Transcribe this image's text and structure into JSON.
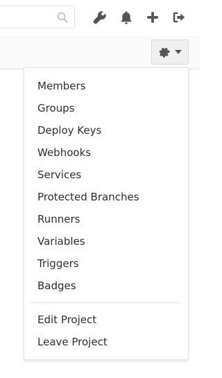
{
  "header": {
    "search": {
      "partial_text": "n"
    },
    "icons": [
      "search-icon",
      "wrench-icon",
      "bell-icon",
      "plus-icon",
      "sign-out-icon"
    ]
  },
  "settings_button": {
    "icon": "gear-icon",
    "caret": "chevron-down-icon"
  },
  "dropdown": {
    "section1": [
      "Members",
      "Groups",
      "Deploy Keys",
      "Webhooks",
      "Services",
      "Protected Branches",
      "Runners",
      "Variables",
      "Triggers",
      "Badges"
    ],
    "section2": [
      "Edit Project",
      "Leave Project"
    ]
  },
  "colors": {
    "icon": "#555555",
    "text": "#2e2e2e",
    "border": "#e5e5e5"
  }
}
